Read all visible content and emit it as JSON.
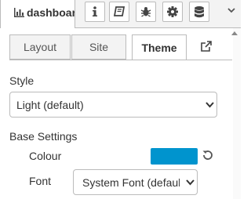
{
  "topbar": {
    "active_tab_label": "dashboard",
    "buttons": [
      {
        "name": "info-icon"
      },
      {
        "name": "book-icon"
      },
      {
        "name": "bug-icon"
      },
      {
        "name": "gear-icon"
      },
      {
        "name": "database-icon"
      }
    ]
  },
  "subtabs": [
    "Layout",
    "Site",
    "Theme"
  ],
  "active_subtab": "Theme",
  "style": {
    "label": "Style",
    "selected": "Light (default)"
  },
  "base_settings": {
    "heading": "Base Settings",
    "colour_label": "Colour",
    "colour_value": "#0094ce",
    "font_label": "Font",
    "font_selected": "System Font (default)"
  }
}
